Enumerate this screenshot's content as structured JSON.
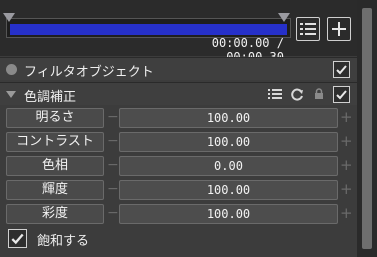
{
  "timeline": {
    "time_current": "00:00.00",
    "time_separator": "/",
    "time_total": "00:00.30"
  },
  "filter_object": {
    "label": "フィルタオブジェクト",
    "checked": true
  },
  "color_correction": {
    "label": "色調補正",
    "checked": true,
    "params": [
      {
        "label": "明るさ",
        "value": "100.00"
      },
      {
        "label": "コントラスト",
        "value": "100.00"
      },
      {
        "label": "色相",
        "value": "0.00"
      },
      {
        "label": "輝度",
        "value": "100.00"
      },
      {
        "label": "彩度",
        "value": "100.00"
      }
    ],
    "saturate": {
      "label": "飽和する",
      "checked": true
    }
  },
  "icons": {
    "list": "list-icon",
    "add": "plus-icon",
    "reload": "reload-icon",
    "lock": "lock-icon",
    "check": "checkmark-icon"
  },
  "colors": {
    "track_fill": "#2630c9",
    "background": "#3c3c3c"
  }
}
